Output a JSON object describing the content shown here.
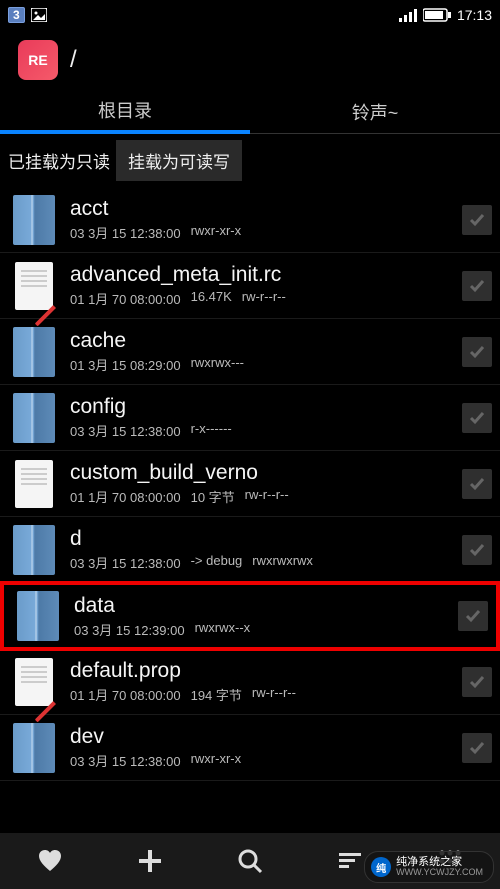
{
  "status_bar": {
    "notification_count": "3",
    "time": "17:13"
  },
  "app": {
    "icon_label": "RE",
    "path": "/"
  },
  "tabs": [
    {
      "label": "根目录",
      "active": true
    },
    {
      "label": "铃声~",
      "active": false
    }
  ],
  "mount": {
    "status": "已挂载为只读",
    "button": "挂载为可读写"
  },
  "files": [
    {
      "type": "folder",
      "name": "acct",
      "date": "03 3月 15 12:38:00",
      "perms": "rwxr-xr-x",
      "highlighted": false
    },
    {
      "type": "file_pencil",
      "name": "advanced_meta_init.rc",
      "date": "01 1月 70 08:00:00",
      "size": "16.47K",
      "perms": "rw-r--r--",
      "highlighted": false
    },
    {
      "type": "folder",
      "name": "cache",
      "date": "01 3月 15 08:29:00",
      "perms": "rwxrwx---",
      "highlighted": false
    },
    {
      "type": "folder",
      "name": "config",
      "date": "03 3月 15 12:38:00",
      "perms": "r-x------",
      "highlighted": false
    },
    {
      "type": "file",
      "name": "custom_build_verno",
      "date": "01 1月 70 08:00:00",
      "size": "10 字节",
      "perms": "rw-r--r--",
      "highlighted": false
    },
    {
      "type": "folder",
      "name": "d",
      "date": "03 3月 15 12:38:00",
      "extra": "-> debug",
      "perms": "rwxrwxrwx",
      "highlighted": false
    },
    {
      "type": "folder",
      "name": "data",
      "date": "03 3月 15 12:39:00",
      "perms": "rwxrwx--x",
      "highlighted": true
    },
    {
      "type": "file_pencil",
      "name": "default.prop",
      "date": "01 1月 70 08:00:00",
      "size": "194 字节",
      "perms": "rw-r--r--",
      "highlighted": false
    },
    {
      "type": "folder",
      "name": "dev",
      "date": "03 3月 15 12:38:00",
      "perms": "rwxr-xr-x",
      "highlighted": false
    }
  ],
  "watermark": {
    "logo_text": "纯",
    "line1": "纯净系统之家",
    "line2": "WWW.YCWJZY.COM"
  }
}
